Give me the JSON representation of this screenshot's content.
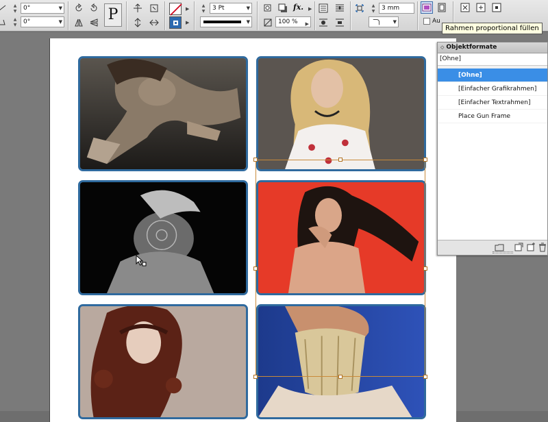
{
  "controlbar": {
    "rotate_angle": "0°",
    "shear_angle": "0°",
    "stroke_weight": "3 Pt",
    "opacity": "100 %",
    "corner_size": "3 mm",
    "letter_p": "P",
    "fx_label": "fx.",
    "auto_label": "Au"
  },
  "tooltip": {
    "text": "Rahmen proportional füllen"
  },
  "panel": {
    "title": "Objektformate",
    "current_style": "[Ohne]",
    "styles": [
      {
        "label": "[Ohne]",
        "selected": true
      },
      {
        "label": "[Einfacher Grafikrahmen]",
        "selected": false
      },
      {
        "label": "[Einfacher Textrahmen]",
        "selected": false
      },
      {
        "label": "Place Gun Frame",
        "selected": false
      }
    ]
  },
  "colors": {
    "frame_stroke": "#2f6a9e",
    "selection": "#c88a3a",
    "selected_item": "#3a8ee6",
    "tooltip_bg": "#ffffe1"
  },
  "photos": [
    {
      "name": "photo-crawling-woman"
    },
    {
      "name": "photo-blonde-woman"
    },
    {
      "name": "photo-monochrome-woman"
    },
    {
      "name": "photo-brunette-red-background"
    },
    {
      "name": "photo-curly-redhead"
    },
    {
      "name": "photo-corset-blue-background"
    }
  ]
}
